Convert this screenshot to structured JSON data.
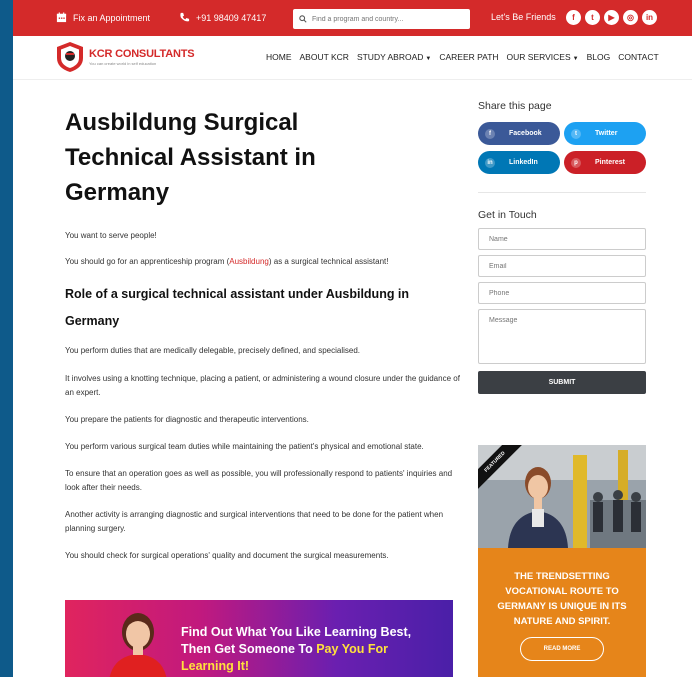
{
  "topbar": {
    "appointment_label": "Fix an Appointment",
    "phone_label": "+91 98409 47417",
    "search_placeholder": "Find a program and country...",
    "social_label": "Let's Be Friends",
    "social_icons": [
      "facebook-icon",
      "twitter-icon",
      "youtube-icon",
      "instagram-icon",
      "linkedin-icon"
    ]
  },
  "logo": {
    "name": "KCR CONSULTANTS",
    "tagline": "You can create world in self education"
  },
  "nav": {
    "items": [
      "HOME",
      "ABOUT KCR",
      "STUDY ABROAD",
      "CAREER PATH",
      "OUR SERVICES",
      "BLOG",
      "CONTACT"
    ]
  },
  "article": {
    "title": "Ausbildung Surgical Technical Assistant in Germany",
    "p1": "You want to serve people!",
    "p2_before": "You should go for an apprenticeship program (",
    "p2_link": "Ausbildung",
    "p2_after": ") as a surgical technical assistant!",
    "h2": "Role of a surgical technical assistant under Ausbildung in Germany",
    "p3": "You perform duties that are medically delegable, precisely defined, and specialised.",
    "p4": "It involves using a knotting technique, placing a patient, or administering a wound closure under the guidance of an expert.",
    "p5": "You prepare the patients for diagnostic and therapeutic interventions.",
    "p6": "You perform various surgical team duties while maintaining the patient's physical and emotional state.",
    "p7": "To ensure that an operation goes as well as possible, you will professionally respond to patients' inquiries and look after their needs.",
    "p8": "Another activity is arranging diagnostic and surgical interventions that need to be done for the patient when planning surgery.",
    "p9": "You should check for surgical operations' quality and document the surgical measurements.",
    "banner_line1": "Find Out What You Like Learning Best,",
    "banner_line2a": "Then Get Someone To ",
    "banner_line2b": "Pay You For",
    "banner_line3": "Learning It!"
  },
  "sidebar": {
    "share_title": "Share this page",
    "share": [
      {
        "label": "Facebook",
        "color": "#3b5998"
      },
      {
        "label": "Twitter",
        "color": "#1da1f2"
      },
      {
        "label": "LinkedIn",
        "color": "#0077b5"
      },
      {
        "label": "Pinterest",
        "color": "#cb2027"
      }
    ],
    "contact_title": "Get in Touch",
    "name_placeholder": "Name",
    "email_placeholder": "Email",
    "phone_placeholder": "Phone",
    "message_placeholder": "Message",
    "submit_label": "SUBMIT",
    "featured_ribbon": "FEATURED",
    "featured_text": "THE TRENDSETTING VOCATIONAL ROUTE TO GERMANY IS UNIQUE IN ITS NATURE AND SPIRIT.",
    "read_more_label": "READ MORE"
  },
  "colors": {
    "brand_red": "#d42a2a",
    "featured_orange": "#e6851a",
    "submit_dark": "#3b3f44"
  }
}
